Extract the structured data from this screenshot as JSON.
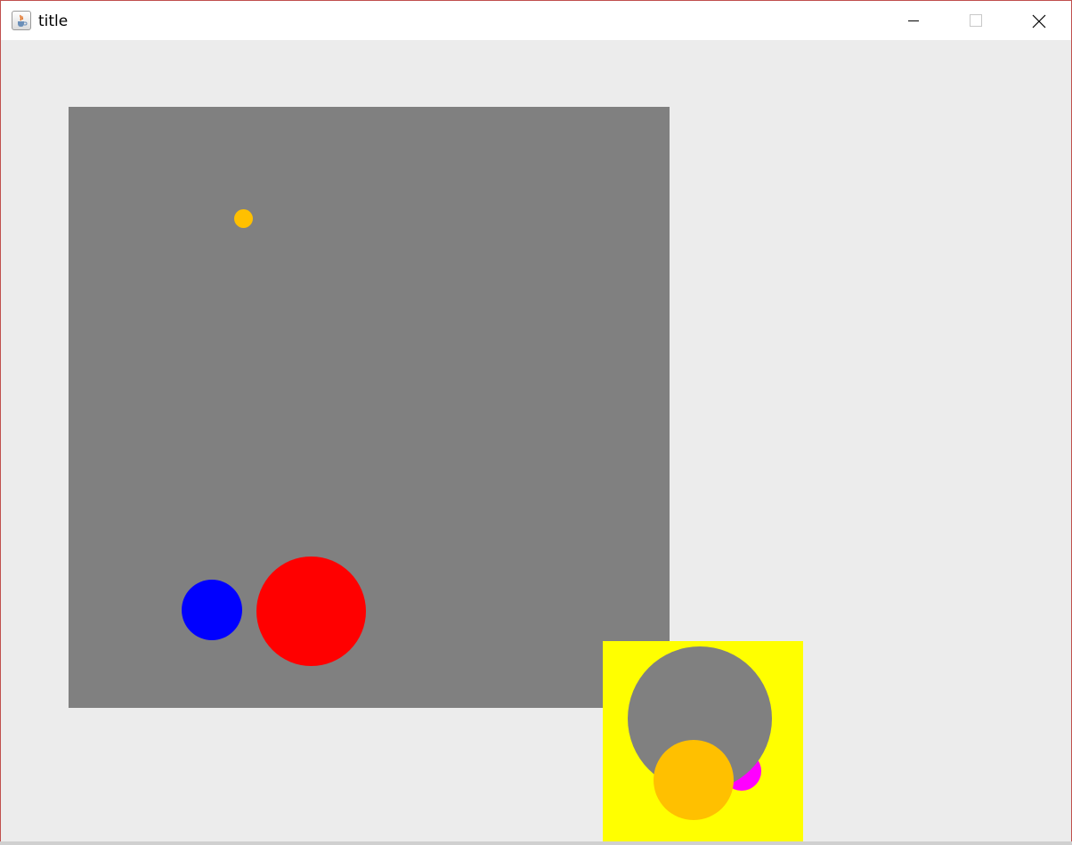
{
  "window": {
    "title": "title",
    "icon": "java-cup-icon",
    "controls": {
      "minimize": "minimize-icon",
      "maximize": "maximize-icon",
      "close": "close-icon"
    }
  },
  "colors": {
    "window_bg": "#ececec",
    "gray_panel": "#808080",
    "yellow_panel": "#ffff00",
    "small_dot": "#ffc000",
    "blue_circle": "#0000ff",
    "red_circle": "#ff0000",
    "gray_circle": "#808080",
    "magenta_circle": "#ff00ff",
    "orange_circle": "#ffc000"
  }
}
